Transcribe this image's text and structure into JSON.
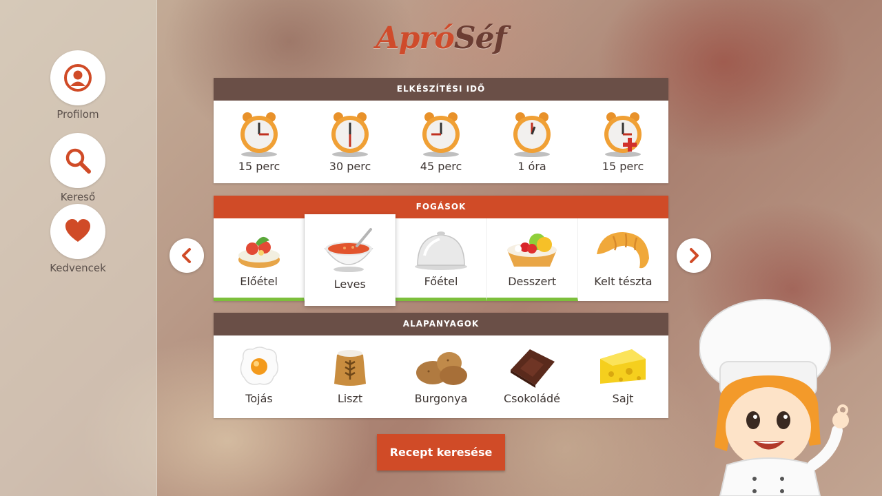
{
  "app": {
    "logo_part1": "Apró",
    "logo_part2": "Séf"
  },
  "sidebar": {
    "items": [
      {
        "label": "Profilom",
        "icon": "profile-icon"
      },
      {
        "label": "Kereső",
        "icon": "search-icon"
      },
      {
        "label": "Kedvencek",
        "icon": "heart-icon"
      }
    ]
  },
  "prep_time": {
    "title": "ELKÉSZÍTÉSI IDŐ",
    "items": [
      {
        "label": "15 perc",
        "icon": "alarm-clock-icon"
      },
      {
        "label": "30 perc",
        "icon": "alarm-clock-icon"
      },
      {
        "label": "45 perc",
        "icon": "alarm-clock-icon"
      },
      {
        "label": "1 óra",
        "icon": "alarm-clock-icon"
      },
      {
        "label": "15 perc",
        "icon": "alarm-clock-plus-icon"
      }
    ]
  },
  "courses": {
    "title": "FOGÁSOK",
    "items": [
      {
        "label": "Előétel",
        "icon": "appetizer-icon"
      },
      {
        "label": "Leves",
        "icon": "soup-icon"
      },
      {
        "label": "Főétel",
        "icon": "cloche-icon"
      },
      {
        "label": "Desszert",
        "icon": "tart-icon"
      },
      {
        "label": "Kelt tészta",
        "icon": "croissant-icon"
      }
    ],
    "selected": "Leves"
  },
  "ingredients": {
    "title": "ALAPANYAGOK",
    "items": [
      {
        "label": "Tojás",
        "icon": "egg-icon"
      },
      {
        "label": "Liszt",
        "icon": "flour-sack-icon"
      },
      {
        "label": "Burgonya",
        "icon": "potato-icon"
      },
      {
        "label": "Csokoládé",
        "icon": "chocolate-icon"
      },
      {
        "label": "Sajt",
        "icon": "cheese-icon"
      }
    ]
  },
  "actions": {
    "search_button": "Recept keresése"
  },
  "colors": {
    "accent": "#d04b27",
    "header_brown": "#6a4f47",
    "selection_green": "#7cbf3c"
  }
}
